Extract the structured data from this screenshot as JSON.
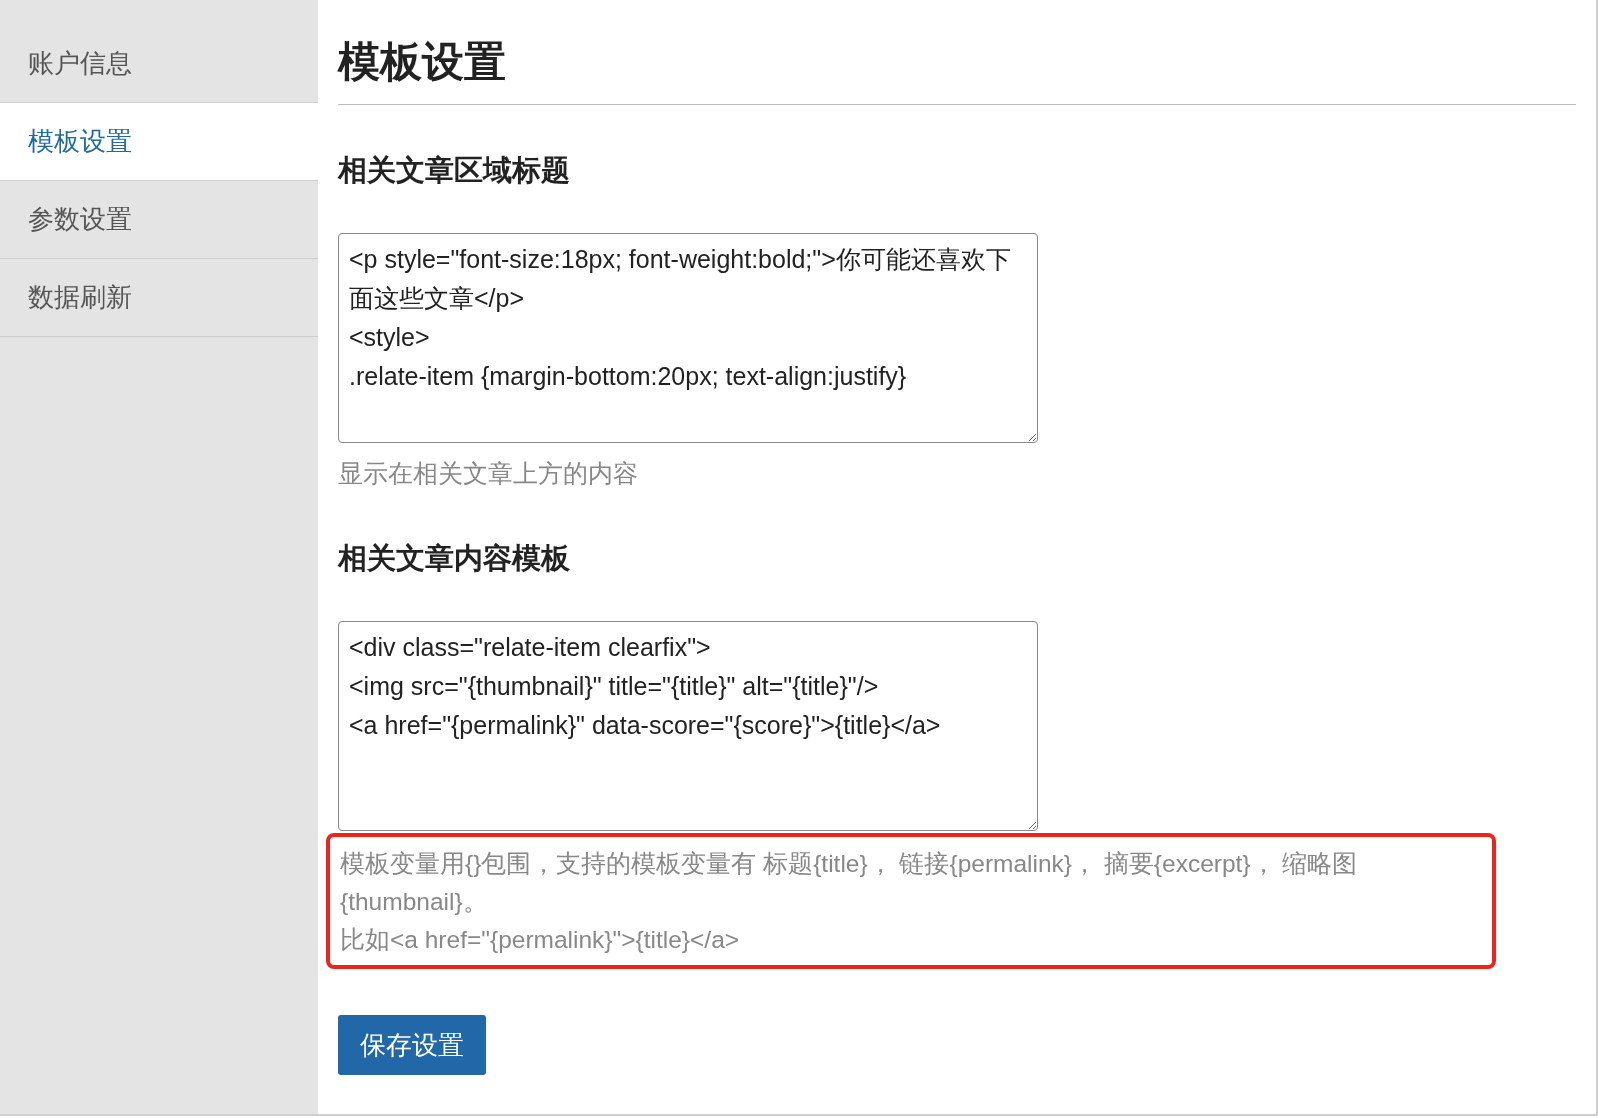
{
  "sidebar": {
    "items": [
      {
        "label": "账户信息",
        "selected": false
      },
      {
        "label": "模板设置",
        "selected": true
      },
      {
        "label": "参数设置",
        "selected": false
      },
      {
        "label": "数据刷新",
        "selected": false
      }
    ]
  },
  "page": {
    "title": "模板设置"
  },
  "sections": [
    {
      "heading": "相关文章区域标题",
      "value": "<p style=\"font-size:18px; font-weight:bold;\">你可能还喜欢下面这些文章</p>\n<style>\n.relate-item {margin-bottom:20px; text-align:justify}",
      "hint": [
        "显示在相关文章上方的内容"
      ],
      "highlighted": false
    },
    {
      "heading": "相关文章内容模板",
      "value": "<div class=\"relate-item clearfix\">\n<img src=\"{thumbnail}\" title=\"{title}\" alt=\"{title}\"/>\n<a href=\"{permalink}\" data-score=\"{score}\">{title}</a>",
      "hint": [
        "模板变量用{}包围，支持的模板变量有 标题{title}， 链接{permalink}， 摘要{excerpt}， 缩略图{thumbnail}。",
        "比如<a href=\"{permalink}\">{title}</a>"
      ],
      "highlighted": true
    }
  ],
  "save_button": {
    "label": "保存设置"
  }
}
